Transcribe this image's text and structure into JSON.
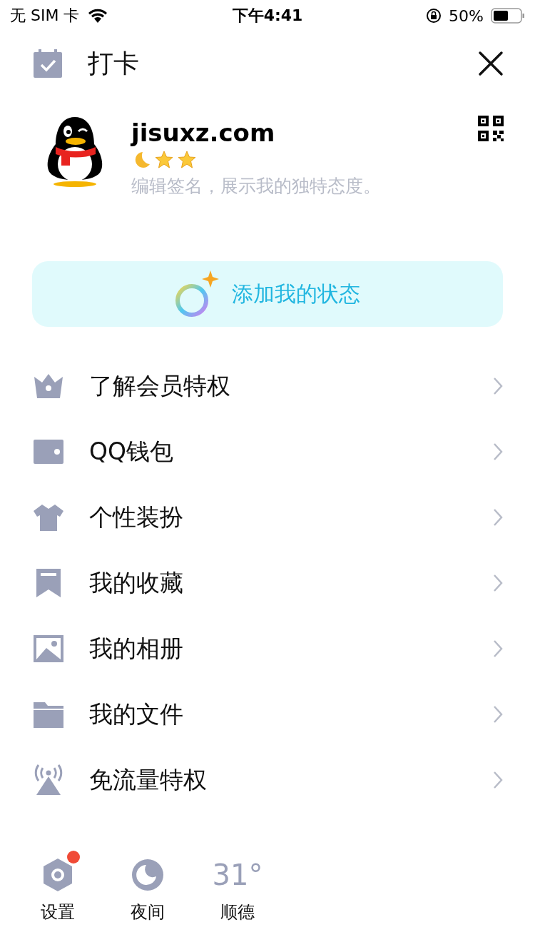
{
  "status_bar": {
    "carrier": "无 SIM 卡",
    "time": "下午4:41",
    "battery": "50%"
  },
  "header": {
    "title": "打卡"
  },
  "profile": {
    "name": "jisuxz.com",
    "badges": [
      {
        "kind": "moon"
      },
      {
        "kind": "star"
      },
      {
        "kind": "star"
      }
    ],
    "signature": "编辑签名，展示我的独特态度。"
  },
  "status_button": {
    "label": "添加我的状态"
  },
  "menu": [
    {
      "kind": "crown",
      "label": "了解会员特权"
    },
    {
      "kind": "wallet",
      "label": "QQ钱包"
    },
    {
      "kind": "shirt",
      "label": "个性装扮"
    },
    {
      "kind": "bookmark",
      "label": "我的收藏"
    },
    {
      "kind": "image",
      "label": "我的相册"
    },
    {
      "kind": "folder",
      "label": "我的文件"
    },
    {
      "kind": "antenna",
      "label": "免流量特权"
    }
  ],
  "bottom": [
    {
      "kind": "gear",
      "label": "设置",
      "notification": true
    },
    {
      "kind": "moon",
      "label": "夜间",
      "notification": false
    },
    {
      "kind": "weather",
      "temperature": "31°",
      "label": "顺德",
      "notification": false
    }
  ]
}
